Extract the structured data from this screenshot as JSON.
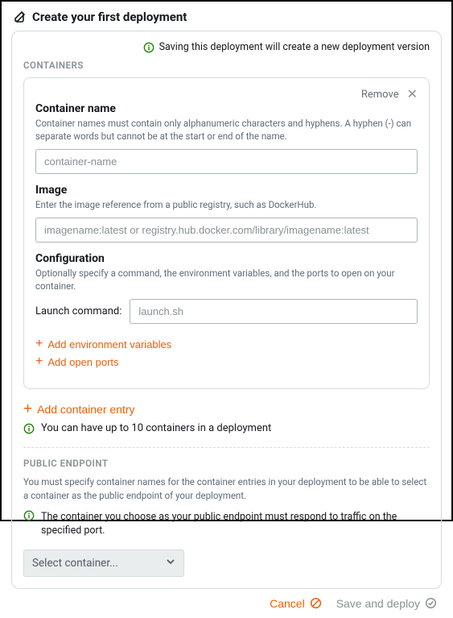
{
  "header": {
    "title": "Create your first deployment"
  },
  "top_info": "Saving this deployment will create a new deployment version",
  "containers_section_label": "CONTAINERS",
  "container": {
    "remove_label": "Remove",
    "name_field": {
      "title": "Container name",
      "desc": "Container names must contain only alphanumeric characters and hyphens. A hyphen (-) can separate words but cannot be at the start or end of the name.",
      "placeholder": "container-name"
    },
    "image_field": {
      "title": "Image",
      "desc": "Enter the image reference from a public registry, such as DockerHub.",
      "placeholder": "imagename:latest or registry.hub.docker.com/library/imagename:latest"
    },
    "config_field": {
      "title": "Configuration",
      "desc": "Optionally specify a command, the environment variables, and the ports to open on your container.",
      "launch_label": "Launch command:",
      "launch_placeholder": "launch.sh",
      "add_env_vars": "Add environment variables",
      "add_open_ports": "Add open ports"
    }
  },
  "add_container_entry": "Add container entry",
  "containers_limit": "You can have up to 10 containers in a deployment",
  "public_endpoint": {
    "label": "PUBLIC ENDPOINT",
    "desc": "You must specify container names for the container entries in your deployment to be able to select a container as the public endpoint of your deployment.",
    "info": "The container you choose as your public endpoint must respond to traffic on the specified port.",
    "select_placeholder": "Select container..."
  },
  "footer": {
    "cancel": "Cancel",
    "save": "Save and deploy"
  }
}
